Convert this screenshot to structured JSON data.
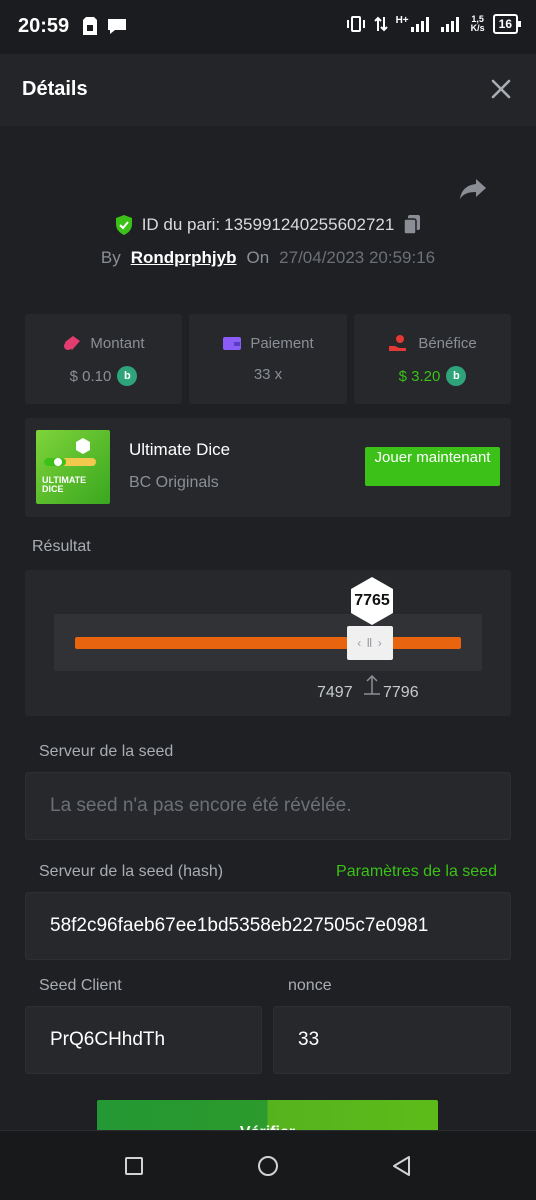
{
  "status_bar": {
    "time": "20:59",
    "network_type": "H+",
    "speed_value": "1,5",
    "speed_unit": "K/s",
    "battery": "16"
  },
  "header": {
    "title": "Détails"
  },
  "bet": {
    "id_label": "ID du pari:",
    "id_value": "135991240255602721",
    "by_label": "By",
    "username": "Rondprphjyb",
    "on_label": "On",
    "datetime": "27/04/2023 20:59:16"
  },
  "stats": [
    {
      "label": "Montant",
      "value": "$ 0.10",
      "icon": "money-bag-icon"
    },
    {
      "label": "Paiement",
      "value": "33 x",
      "icon": "wallet-icon"
    },
    {
      "label": "Bénéfice",
      "value": "$ 3.20",
      "icon": "hand-coin-icon"
    }
  ],
  "game": {
    "name": "Ultimate Dice",
    "provider": "BC Originals",
    "thumb_text": "ULTIMATE DICE",
    "play_label": "Jouer maintenant"
  },
  "result": {
    "label": "Résultat",
    "value": "7765",
    "range_low": "7497",
    "range_high": "7796"
  },
  "seed": {
    "server_label": "Serveur de la seed",
    "server_placeholder": "La seed n'a pas encore été révélée.",
    "hash_label": "Serveur de la seed (hash)",
    "settings_link": "Paramètres de la seed",
    "hash_value": "58f2c96faeb67ee1bd5358eb227505c7e0981",
    "client_label": "Seed Client",
    "client_value": "PrQ6CHhdTh",
    "nonce_label": "nonce",
    "nonce_value": "33"
  },
  "verify_button": {
    "label": "Vérifier"
  },
  "colors": {
    "accent_green": "#3bc117",
    "orange": "#e8640e",
    "background": "#1e2023",
    "card": "#26282c"
  }
}
